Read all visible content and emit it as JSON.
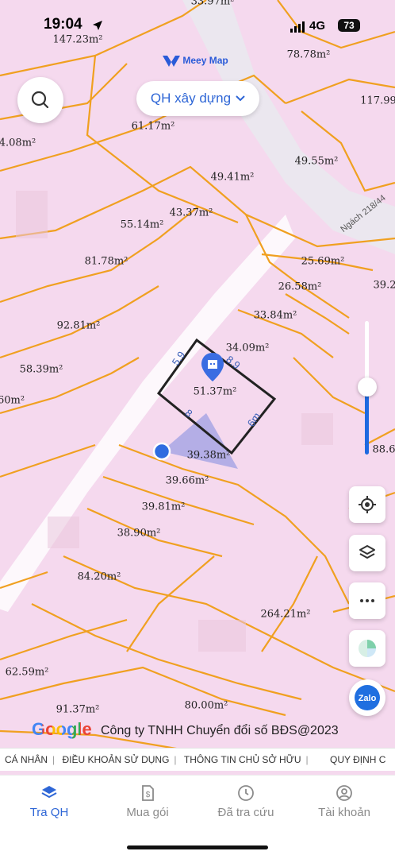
{
  "status_bar": {
    "time": "19:04",
    "network": "4G",
    "battery": "73"
  },
  "brand": {
    "logo_text": "Meey Map"
  },
  "toolbar": {
    "layer_select": "QH xây dựng"
  },
  "map": {
    "lots": [
      {
        "label": "33.97m²"
      },
      {
        "label": "147.23m²"
      },
      {
        "label": "78.78m²"
      },
      {
        "label": "117.99"
      },
      {
        "label": "61.17m²"
      },
      {
        "label": "4.08m²"
      },
      {
        "label": "49.55m²"
      },
      {
        "label": "49.41m²"
      },
      {
        "label": "43.37m²"
      },
      {
        "label": "55.14m²"
      },
      {
        "label": "81.78m²"
      },
      {
        "label": "25.69m²"
      },
      {
        "label": "26.58m²"
      },
      {
        "label": "39.2"
      },
      {
        "label": "33.84m²"
      },
      {
        "label": "92.81m²"
      },
      {
        "label": "34.09m²"
      },
      {
        "label": "58.39m²"
      },
      {
        "label": "51.37m²"
      },
      {
        "label": "60m²"
      },
      {
        "label": "39.38m²"
      },
      {
        "label": "88.6"
      },
      {
        "label": "39.66m²"
      },
      {
        "label": "39.81m²"
      },
      {
        "label": "38.90m²"
      },
      {
        "label": "84.20m²"
      },
      {
        "label": "264.21m²"
      },
      {
        "label": "62.59m²"
      },
      {
        "label": "91.37m²"
      },
      {
        "label": "80.00m²"
      }
    ],
    "dimensions": {
      "side_a": "5.9",
      "side_b": "8.9",
      "side_c": "6m",
      "side_d": "8"
    },
    "street_label": "Ngách 218/44",
    "zoom_level": 0.5
  },
  "attribution": {
    "google": "Google",
    "copyright": "Công ty TNHH Chuyển đổi số BĐS@2023"
  },
  "ticker": [
    "CÁ NHÂN",
    "ĐIỀU KHOẢN SỬ DỤNG",
    "THÔNG TIN CHỦ SỞ HỮU",
    "QUY ĐỊNH C"
  ],
  "bottom_nav": [
    {
      "label": "Tra QH",
      "active": true
    },
    {
      "label": "Mua gói",
      "active": false
    },
    {
      "label": "Đã tra cứu",
      "active": false
    },
    {
      "label": "Tài khoản",
      "active": false
    }
  ],
  "colors": {
    "accent": "#2e66d6",
    "lot_border": "#f0a020",
    "map_bg": "#f5d9ee",
    "selected_outline": "#222222"
  }
}
